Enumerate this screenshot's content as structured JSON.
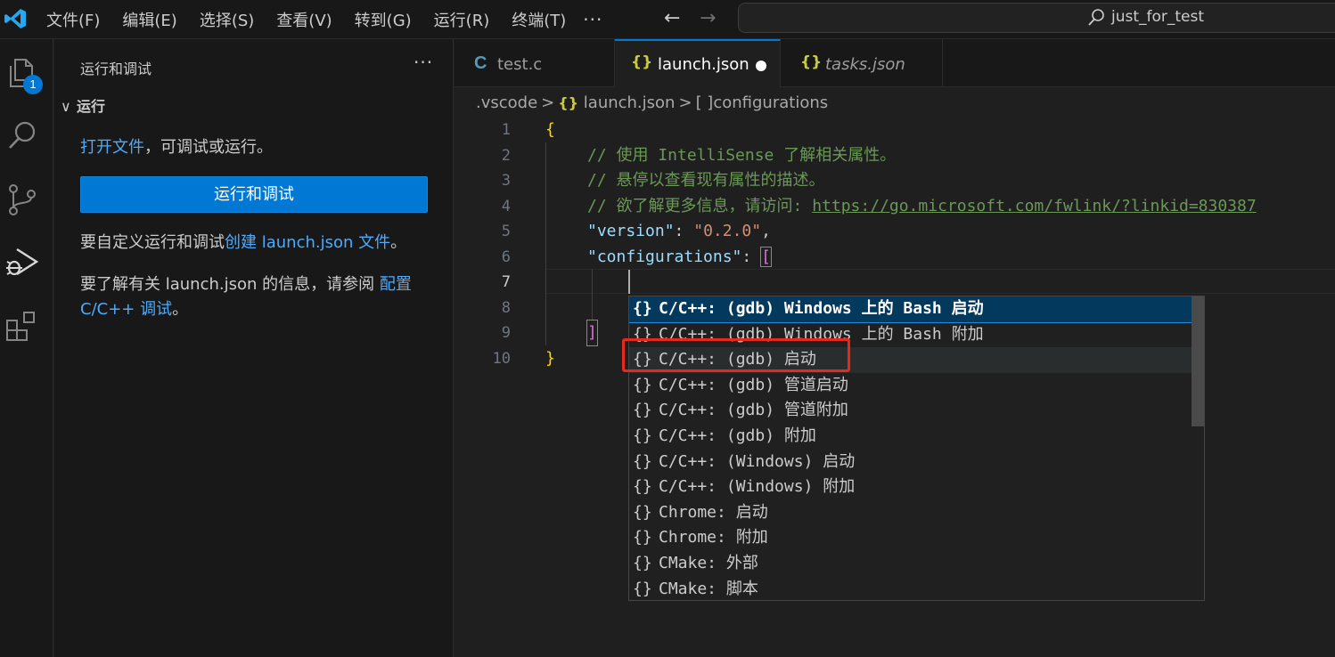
{
  "titlebar": {
    "menu": [
      "文件(F)",
      "编辑(E)",
      "选择(S)",
      "查看(V)",
      "转到(G)",
      "运行(R)",
      "终端(T)"
    ],
    "more": "···",
    "search_text": "just_for_test"
  },
  "activity": {
    "explorer_badge": "1"
  },
  "sidebar": {
    "title": "运行和调试",
    "more": "···",
    "section": "运行",
    "open_file_link": "打开文件",
    "open_file_rest": "，可调试或运行。",
    "run_button": "运行和调试",
    "customize_prefix": "要自定义运行和调试",
    "customize_link": "创建 launch.json 文件",
    "customize_suffix": "。",
    "learn_prefix": "要了解有关 launch.json 的信息，请参阅 ",
    "learn_link_1": "配置",
    "learn_link_2": "C/C++ 调试",
    "learn_suffix": "。"
  },
  "tabs": [
    {
      "icon": "C",
      "label": "test.c"
    },
    {
      "icon": "{}",
      "label": "launch.json"
    },
    {
      "icon": "{}",
      "label": "tasks.json"
    }
  ],
  "breadcrumb": {
    "folder": ".vscode",
    "file_icon": "{}",
    "file": "launch.json",
    "node_icon": "[ ]",
    "node": "configurations",
    "separator": ">"
  },
  "editor": {
    "line_numbers": [
      "1",
      "2",
      "3",
      "4",
      "5",
      "6",
      "7",
      "8",
      "9",
      "10"
    ],
    "code": {
      "l1": "{",
      "l2": "// 使用 IntelliSense 了解相关属性。",
      "l3": "// 悬停以查看现有属性的描述。",
      "l4_prefix": "// 欲了解更多信息，请访问: ",
      "l4_link": "https://go.microsoft.com/fwlink/?linkid=830387",
      "l5_key": "\"version\"",
      "l5_colon": ": ",
      "l5_val": "\"0.2.0\"",
      "l5_comma": ",",
      "l6_key": "\"configurations\"",
      "l6_colon": ": ",
      "l6_bracket": "[",
      "l9": "]",
      "l10": "}"
    }
  },
  "suggest": {
    "icon": "{}",
    "items": [
      "C/C++: (gdb) Windows 上的 Bash 启动",
      "C/C++: (gdb) Windows 上的 Bash 附加",
      "C/C++: (gdb) 启动",
      "C/C++: (gdb) 管道启动",
      "C/C++: (gdb) 管道附加",
      "C/C++: (gdb) 附加",
      "C/C++: (Windows) 启动",
      "C/C++: (Windows) 附加",
      "Chrome: 启动",
      "Chrome: 附加",
      "CMake: 外部",
      "CMake: 脚本"
    ]
  },
  "colors": {
    "accent": "#0078d4",
    "highlight_box": "#e8281c"
  }
}
